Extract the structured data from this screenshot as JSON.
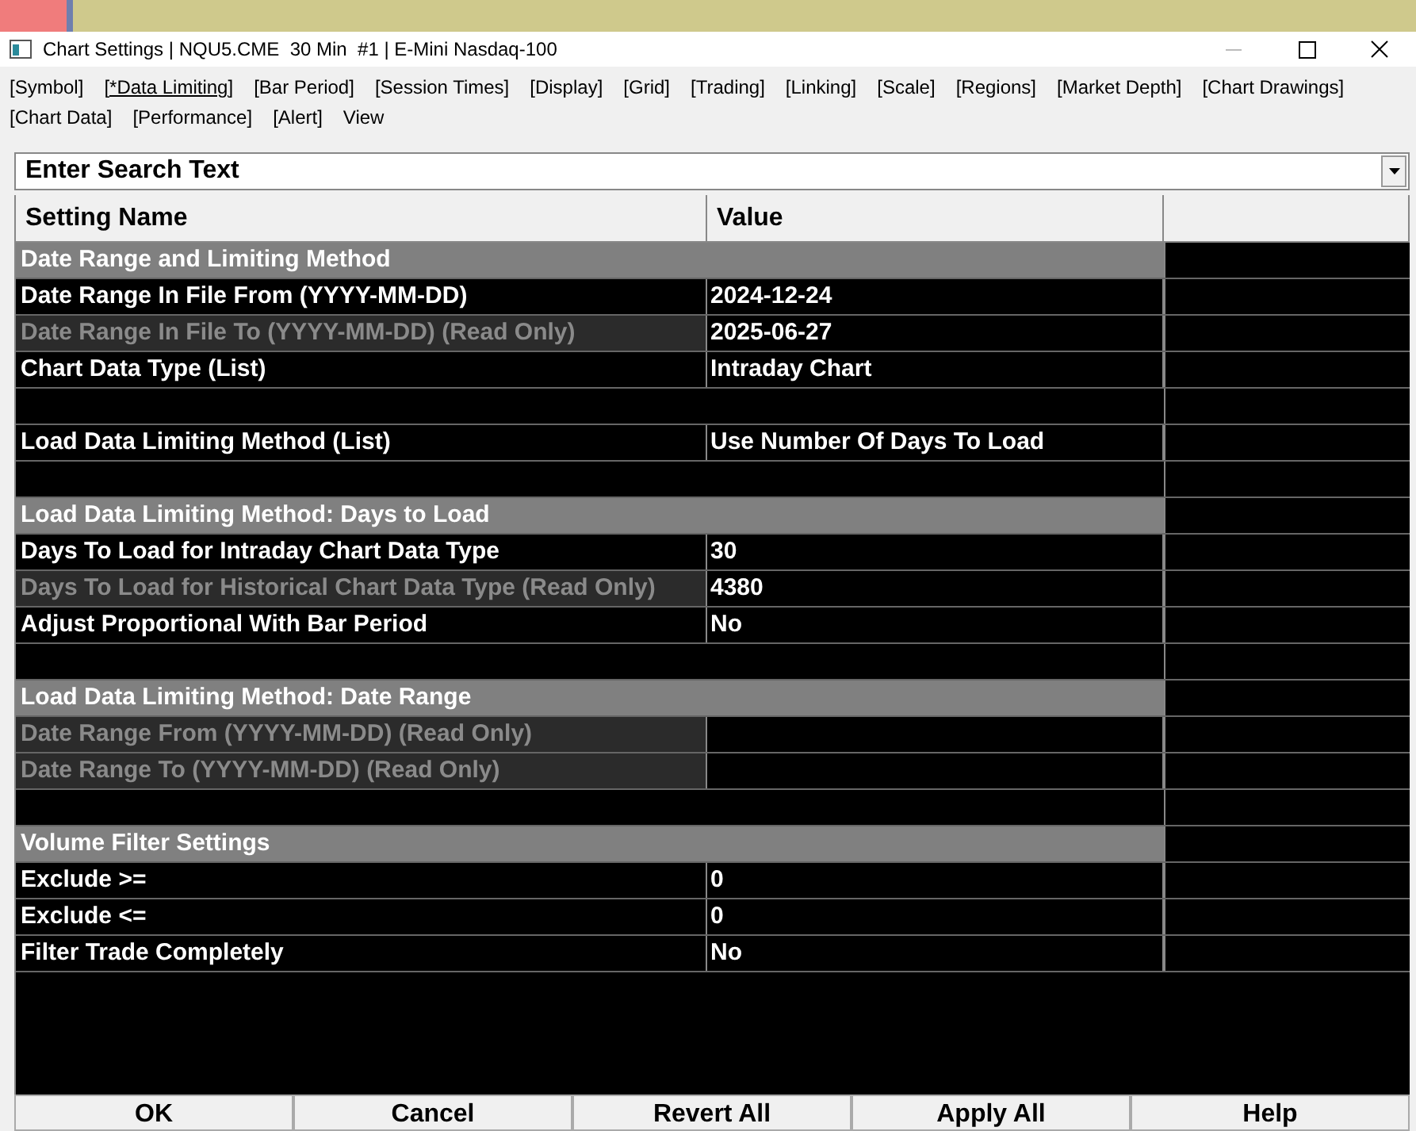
{
  "window": {
    "title": "Chart Settings | NQU5.CME  30 Min  #1 | E-Mini Nasdaq-100"
  },
  "tabs": [
    {
      "label": "[Symbol]",
      "selected": false
    },
    {
      "label": "[*Data Limiting]",
      "selected": true
    },
    {
      "label": "[Bar Period]",
      "selected": false
    },
    {
      "label": "[Session Times]",
      "selected": false
    },
    {
      "label": "[Display]",
      "selected": false
    },
    {
      "label": "[Grid]",
      "selected": false
    },
    {
      "label": "[Trading]",
      "selected": false
    },
    {
      "label": "[Linking]",
      "selected": false
    },
    {
      "label": "[Scale]",
      "selected": false
    },
    {
      "label": "[Regions]",
      "selected": false
    },
    {
      "label": "[Market Depth]",
      "selected": false
    },
    {
      "label": "[Chart Drawings]",
      "selected": false
    },
    {
      "label": "[Chart Data]",
      "selected": false
    },
    {
      "label": "[Performance]",
      "selected": false
    },
    {
      "label": "[Alert]",
      "selected": false
    },
    {
      "label": "View",
      "selected": false
    }
  ],
  "search": {
    "placeholder": "Enter Search Text"
  },
  "table": {
    "columns": [
      "Setting Name",
      "Value"
    ],
    "rows": [
      {
        "kind": "group",
        "name": "Date Range and Limiting Method"
      },
      {
        "kind": "setting",
        "name": "Date Range In File From (YYYY-MM-DD)",
        "value": "2024-12-24",
        "read_only": false
      },
      {
        "kind": "setting",
        "name": "Date Range In File To (YYYY-MM-DD) (Read Only)",
        "value": "2025-06-27",
        "read_only": true
      },
      {
        "kind": "setting",
        "name": "Chart Data Type (List)",
        "value": "Intraday Chart",
        "read_only": false
      },
      {
        "kind": "blank"
      },
      {
        "kind": "setting",
        "name": "Load Data Limiting Method (List)",
        "value": "Use Number Of Days To Load",
        "read_only": false
      },
      {
        "kind": "blank"
      },
      {
        "kind": "group",
        "name": "Load Data Limiting Method: Days to Load"
      },
      {
        "kind": "setting",
        "name": "Days To Load for Intraday Chart Data Type",
        "value": "30",
        "read_only": false
      },
      {
        "kind": "setting",
        "name": "Days To Load for Historical Chart Data Type (Read Only)",
        "value": "4380",
        "read_only": true
      },
      {
        "kind": "setting",
        "name": "Adjust Proportional With Bar Period",
        "value": "No",
        "read_only": false
      },
      {
        "kind": "blank"
      },
      {
        "kind": "group",
        "name": "Load Data Limiting Method: Date Range"
      },
      {
        "kind": "setting",
        "name": "Date Range From (YYYY-MM-DD) (Read Only)",
        "read_only": true
      },
      {
        "kind": "setting",
        "name": "Date Range To (YYYY-MM-DD) (Read Only)",
        "read_only": true
      },
      {
        "kind": "blank"
      },
      {
        "kind": "group",
        "name": "Volume Filter Settings"
      },
      {
        "kind": "setting",
        "name": "Exclude >=",
        "value": "0",
        "read_only": false
      },
      {
        "kind": "setting",
        "name": "Exclude <=",
        "value": "0",
        "read_only": false
      },
      {
        "kind": "setting",
        "name": "Filter Trade Completely",
        "value": "No",
        "read_only": false
      }
    ]
  },
  "buttons": [
    "OK",
    "Cancel",
    "Revert All",
    "Apply All",
    "Help"
  ]
}
